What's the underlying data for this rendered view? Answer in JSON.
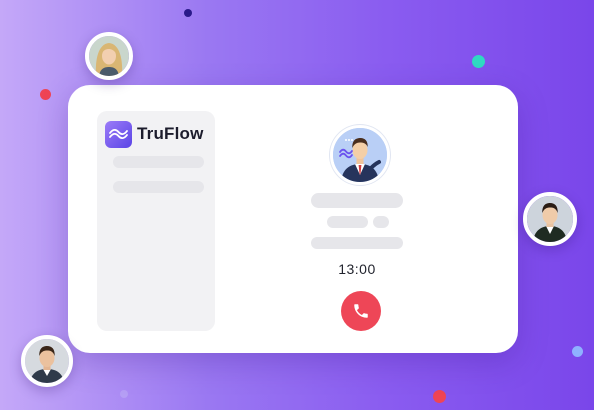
{
  "app": {
    "brand_name": "TruFlow"
  },
  "call": {
    "timer": "13:00"
  },
  "icons": {
    "logo": "truflow-logo-icon",
    "end_call": "phone-hangup-icon"
  },
  "colors": {
    "background_start": "#c4a8f8",
    "background_end": "#7a46ea",
    "end_call": "#ee4657",
    "card": "#ffffff",
    "skeleton": "#e6e6ea"
  }
}
